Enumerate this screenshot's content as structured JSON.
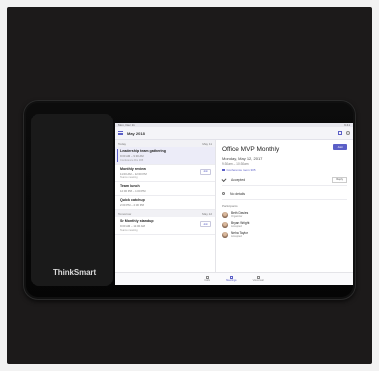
{
  "device": {
    "brand": "ThinkSmart"
  },
  "status_bar": {
    "left": "Mon, Dec 11",
    "right": "9:41"
  },
  "app_bar": {
    "title": "May 2018"
  },
  "agenda": {
    "today_label": "Today",
    "today_date": "May 11",
    "tomorrow_label": "Tomorrow",
    "tomorrow_date": "May 12",
    "events": [
      {
        "title": "Leadership team gathering",
        "time": "9:00 AM – 9:30 AM",
        "sub": "Conference Rm 305"
      },
      {
        "title": "Monthly review",
        "time": "11:00 AM – 12:00 PM",
        "sub": "Teams meeting",
        "chip": "Join"
      },
      {
        "title": "Team lunch",
        "time": "12:00 PM – 1:00 PM",
        "sub": ""
      },
      {
        "title": "Quick catchup",
        "time": "2:00 PM – 2:30 PM",
        "sub": ""
      }
    ],
    "tomorrow_events": [
      {
        "title": "Sr Monthly standup",
        "time": "9:00 AM – 11:00 AM",
        "sub": "Teams meeting",
        "chip": "Join"
      }
    ]
  },
  "detail": {
    "join_label": "Join",
    "title": "Office MVP Monthly",
    "date": "Monday, May 12, 2017",
    "time": "9:30am – 10:30am",
    "room": "Conference room 305",
    "accepted_label": "Accepted",
    "reply_label": "Reply",
    "no_details_label": "No details",
    "participants_label": "Participants",
    "participants": [
      {
        "name": "Beth Davies",
        "role": "Organizer"
      },
      {
        "name": "Bryan Wright",
        "role": "Accepted"
      },
      {
        "name": "Neha Taylor",
        "role": "Accepted"
      }
    ]
  },
  "tabs": [
    {
      "label": "Calls"
    },
    {
      "label": "Meetings"
    },
    {
      "label": "Voicemail"
    }
  ],
  "colors": {
    "accent": "#5b5fc7"
  }
}
